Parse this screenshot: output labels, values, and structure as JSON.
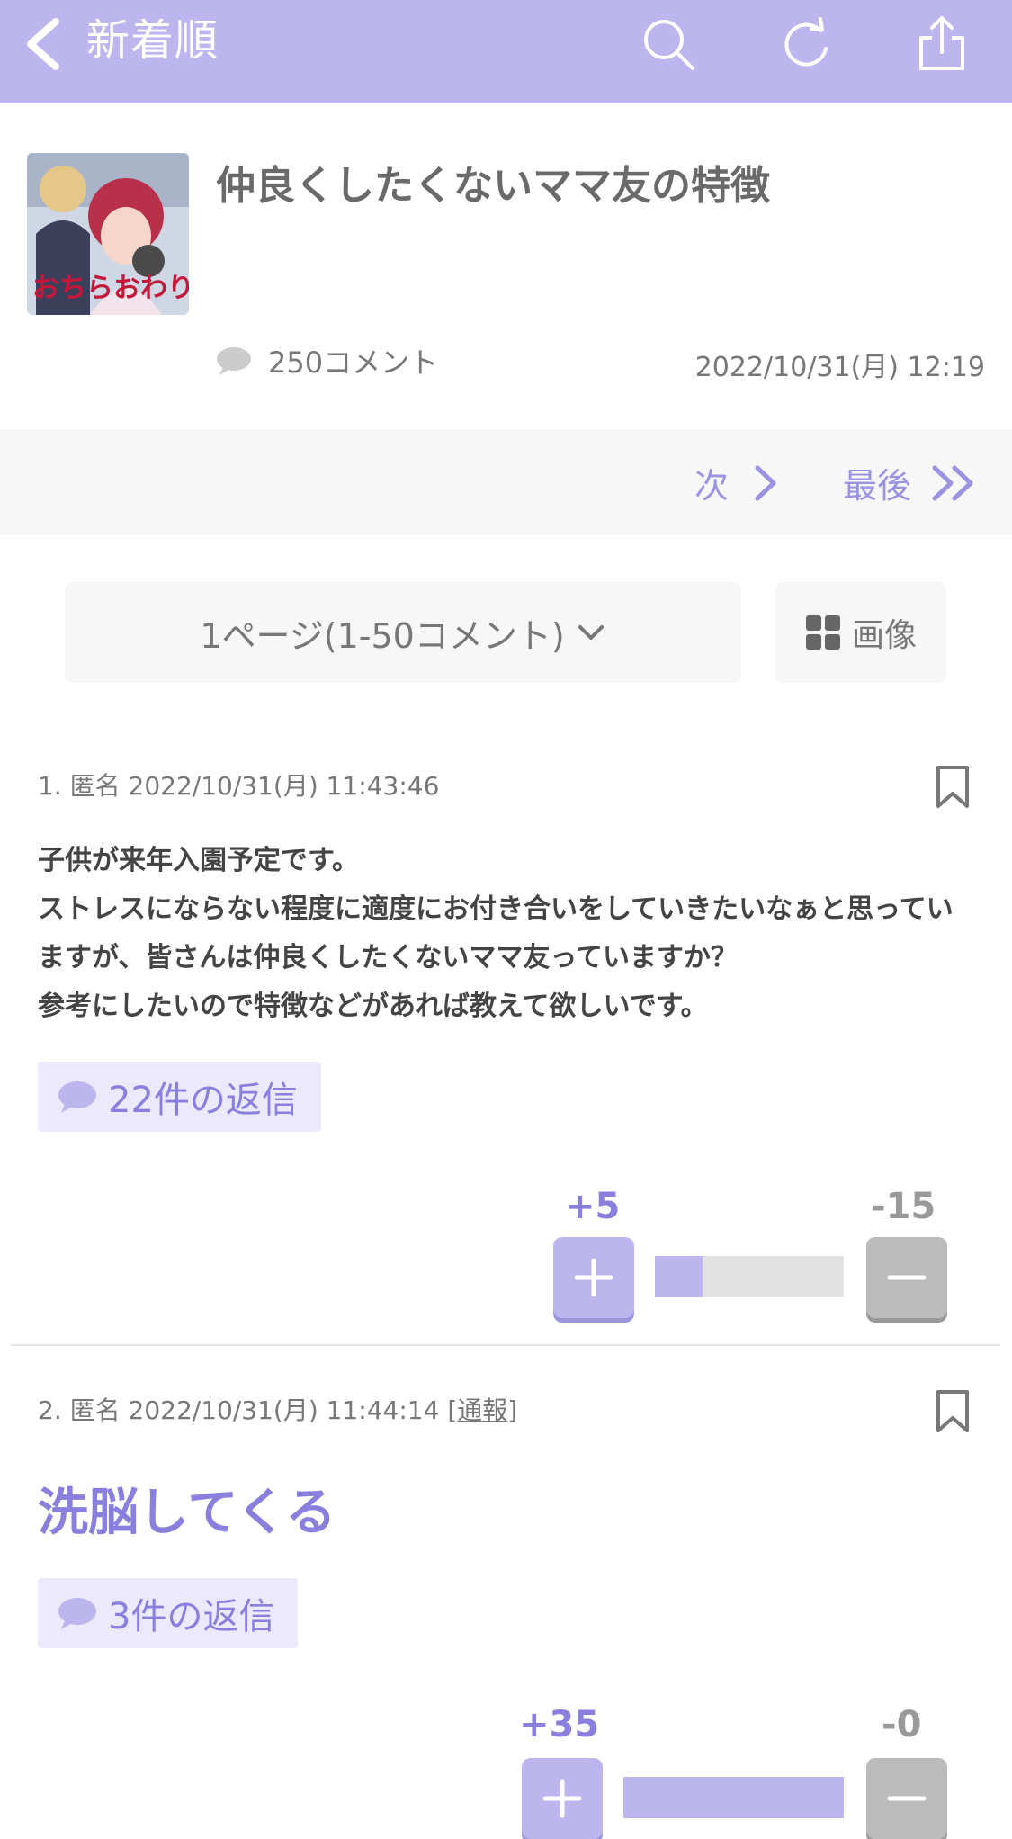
{
  "topbar": {
    "title": "新着順",
    "icons": [
      "back-icon",
      "search-icon",
      "refresh-icon",
      "share-icon"
    ],
    "bg_color": "#bdb6ee"
  },
  "article": {
    "title": "仲良くしたくないママ友の特徴",
    "comments_label": "250コメント",
    "date": "2022/10/31(月) 12:19",
    "thumbnail_caption": "おちらおわり"
  },
  "pager": {
    "next_label": "次",
    "last_label": "最後"
  },
  "page_select": {
    "value": "1ページ(1-50コメント)"
  },
  "image_button": {
    "label": "画像"
  },
  "comments": [
    {
      "meta": "1. 匿名 2022/10/31(月) 11:43:46",
      "body": "子供が来年入園予定です。\nストレスにならない程度に適度にお付き合いをしていきたいなぁと思っていますが、皆さんは仲良くしたくないママ友っていますか？\n参考にしたいので特徴などがあれば教えて欲しいです。",
      "reply_label": "22件の返信",
      "plus": "+5",
      "minus": "-15",
      "plus_ratio": 0.25
    },
    {
      "meta": "2. 匿名 2022/10/31(月) 11:44:14",
      "report_label": "通報",
      "body": "洗脳してくる",
      "reply_label": "3件の返信",
      "plus": "+35",
      "minus": "-0",
      "plus_ratio": 1.0
    }
  ],
  "colors": {
    "accent": "#8a7fdc",
    "accent_light": "#bdb6ee",
    "reply_bg": "#ebe9fb"
  }
}
